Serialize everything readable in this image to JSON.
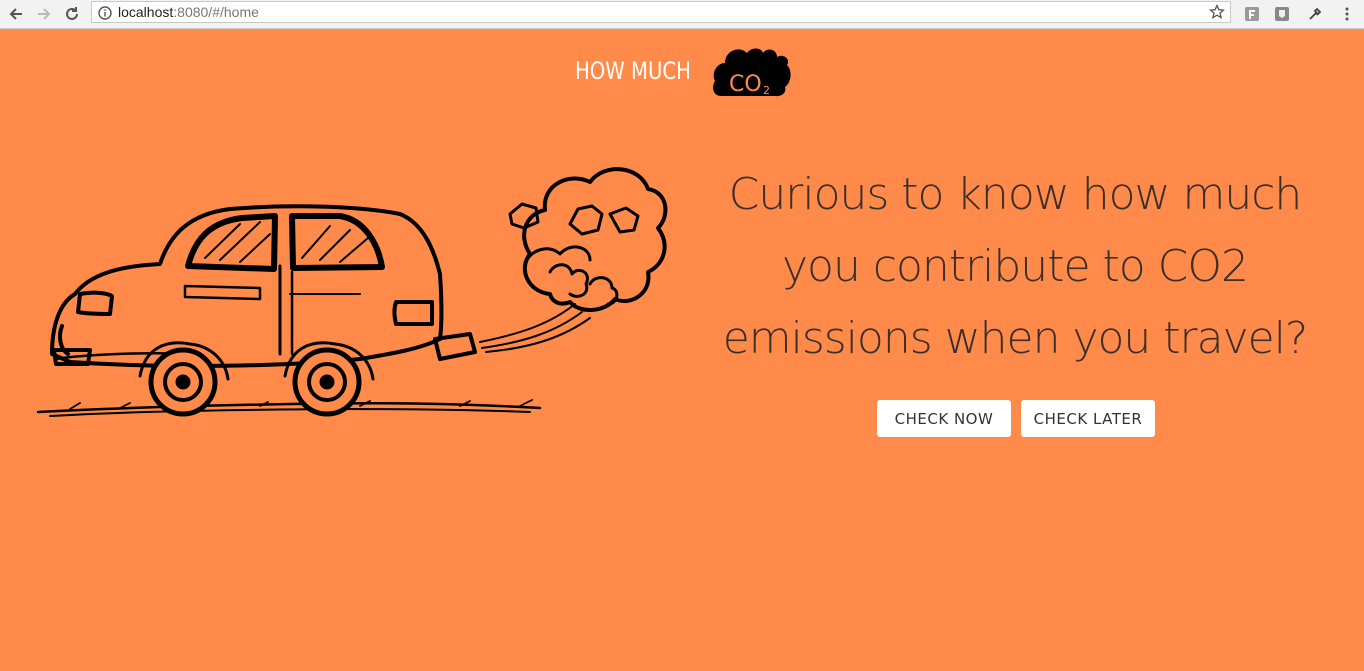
{
  "browser": {
    "url_host": "localhost",
    "url_rest": ":8080/#/home"
  },
  "header": {
    "brand_text": "HOW MUCH",
    "logo_cloud_text": "CO",
    "logo_cloud_sub": "2"
  },
  "hero": {
    "headline": "Curious to know how much you contribute to CO2 emissions when you travel?",
    "check_now_label": "CHECK NOW",
    "check_later_label": "CHECK LATER"
  },
  "colors": {
    "background": "#ff8a4a",
    "text_dark": "#3a2f2a",
    "button_bg": "#ffffff"
  },
  "icons": [
    "back-arrow-icon",
    "forward-arrow-icon",
    "reload-icon",
    "info-icon",
    "star-icon",
    "extension-icon",
    "eyedropper-icon",
    "menu-dots-icon",
    "co2-cloud-icon",
    "car-illustration"
  ]
}
